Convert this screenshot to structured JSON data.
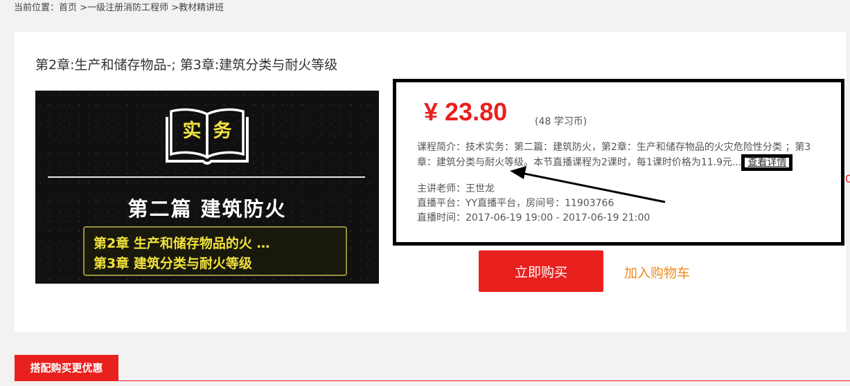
{
  "breadcrumb": {
    "prefix": "当前位置：",
    "items": [
      "首页",
      " >一级注册消防工程师",
      " >教材精讲班"
    ]
  },
  "course": {
    "title": "第2章:生产和储存物品-; 第3章:建筑分类与耐火等级",
    "cover": {
      "book_label": [
        "实",
        "务"
      ],
      "heading": "第二篇  建筑防火",
      "chapter_1": "第2章  生产和储存物品的火 …",
      "chapter_2": "第3章  建筑分类与耐火等级"
    },
    "price": "¥ 23.80",
    "price_coin": "(48  学习币)",
    "intro": "课程简介：技术实务：第二篇：建筑防火，第2章：生产和储存物品的火灾危险性分类  ；第3章：建筑分类与耐火等级。本节直播课程为2课时，每1课时价格为11.9元...",
    "detail_link": "查看详情",
    "teacher": "主讲老师：王世龙",
    "platform": "直播平台：YY直播平台，房间号：11903766",
    "schedule": "直播时间：2017-06-19 19:00 - 2017-06-19 21:00",
    "buy_label": "立即购买",
    "cart_label": "加入购物车"
  },
  "promo_tab": "搭配购买更优惠",
  "edge_mark": "0",
  "colors": {
    "accent_red": "#e8211e",
    "cart_orange": "#f0891d",
    "cover_yellow": "#f2e23c",
    "page_bg": "#f2f2f2"
  }
}
